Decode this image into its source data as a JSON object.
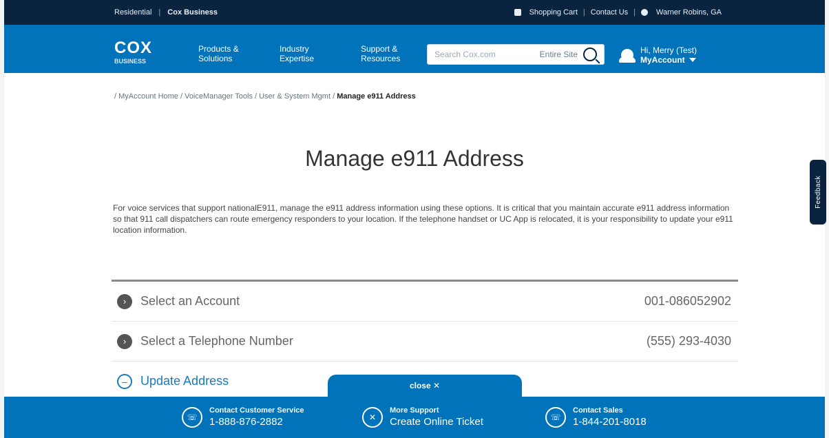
{
  "utility": {
    "left": [
      "Residential",
      "Cox Business"
    ],
    "right": [
      "Shopping Cart",
      "Contact Us",
      "Warner Robins, GA"
    ]
  },
  "header": {
    "logo": "COX",
    "logo_sub": "BUSINESS",
    "nav": [
      "Products & Solutions",
      "Industry Expertise",
      "Support & Resources"
    ],
    "search": {
      "placeholder": "Search Cox.com",
      "scope": "Entire Site"
    },
    "account": {
      "greeting": "Hi, Merry (Test)",
      "my": "MyAccount"
    }
  },
  "breadcrumb": {
    "prefix": "/ MyAccount Home / VoiceManager Tools / User & System Mgmt / ",
    "current": "Manage e911 Address"
  },
  "page": {
    "title": "Manage e911 Address",
    "intro": "For voice services that support nationalE911, manage the e911 address information using these options. It is critical that you maintain accurate e911 address information so that 911 call dispatchers can route emergency responders to your location. If the telephone handset or UC App is relocated, it is your responsibility to update your e911 location information."
  },
  "steps": [
    {
      "label": "Select an Account",
      "value": "001-086052902"
    },
    {
      "label": "Select a Telephone Number",
      "value": "(555) 293-4030"
    },
    {
      "label": "Update Address",
      "value": ""
    }
  ],
  "footer": {
    "close": "close ✕",
    "items": [
      {
        "small": "Contact Customer Service",
        "big": "1-888-876-2882",
        "icon": "phone-icon"
      },
      {
        "small": "More Support",
        "big": "Create Online Ticket",
        "icon": "ticket-icon"
      },
      {
        "small": "Contact Sales",
        "big": "1-844-201-8018",
        "icon": "phone-icon"
      }
    ]
  },
  "feedback": "Feedback",
  "colors": {
    "brand_blue": "#0073bb",
    "navy": "#0a2440"
  }
}
